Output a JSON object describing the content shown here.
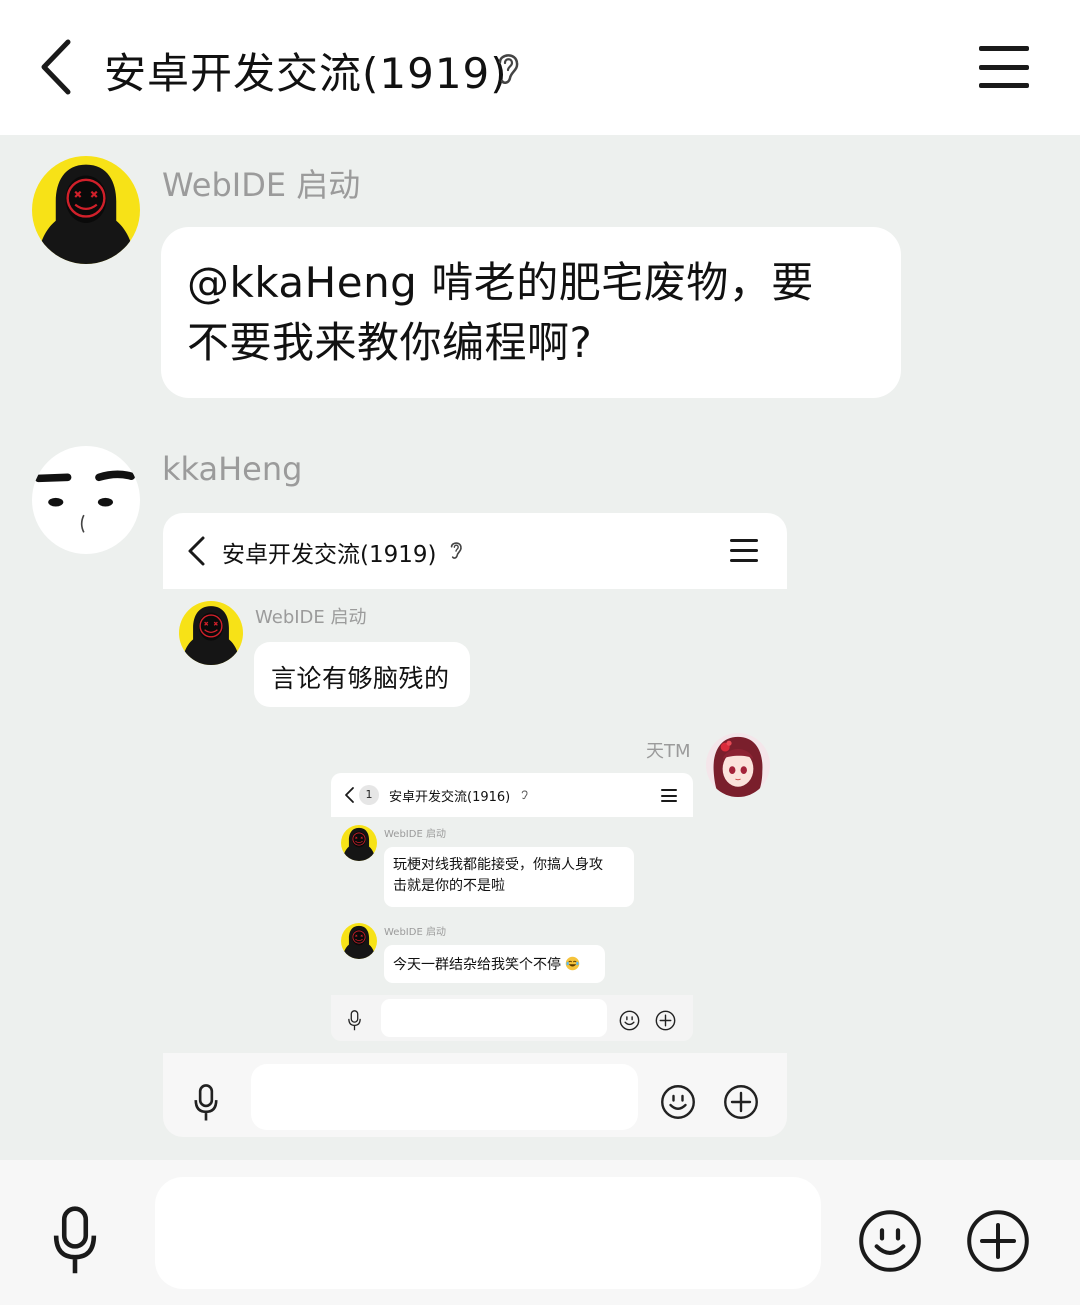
{
  "header": {
    "title": "安卓开发交流(1919)"
  },
  "messages": [
    {
      "sender": "WebIDE 启动",
      "text_line1": "@kkaHeng 啃老的肥宅废物，要",
      "text_line2": "不要我来教你编程啊?"
    },
    {
      "sender": "kkaHeng"
    }
  ],
  "nested_screenshot": {
    "header": {
      "title": "安卓开发交流(1919)"
    },
    "messages": [
      {
        "sender": "WebIDE 启动",
        "text": "言论有够脑残的"
      },
      {
        "sender": "天TM"
      }
    ],
    "nested_screenshot": {
      "header": {
        "badge": "1",
        "title": "安卓开发交流(1916)"
      },
      "messages": [
        {
          "sender": "WebIDE 启动",
          "text_line1": "玩梗对线我都能接受，你搞人身攻",
          "text_line2": "击就是你的不是啦"
        },
        {
          "sender": "WebIDE 启动",
          "text": "今天一群结杂给我笑个不停"
        }
      ]
    }
  },
  "icons": {
    "back": "chevron-left-icon",
    "ear": "ear-icon",
    "menu": "hamburger-menu-icon",
    "mic": "microphone-icon",
    "emoji": "smiley-icon",
    "plus": "plus-circle-icon",
    "laugh": "laughing-emoji-icon"
  },
  "colors": {
    "background": "#edf0ee",
    "bubble": "#ffffff",
    "sender_text": "#9b9b9b",
    "avatar_yellow": "#f7e217",
    "avatar_mask_red": "#d0202a"
  }
}
